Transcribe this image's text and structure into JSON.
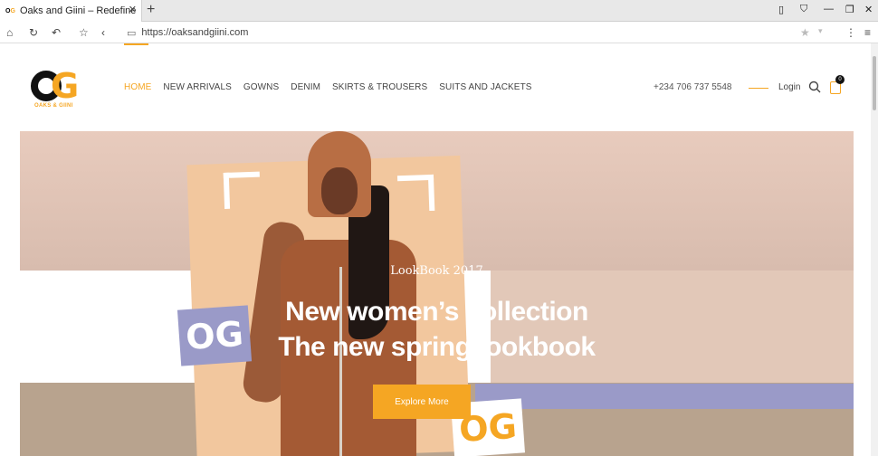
{
  "browser": {
    "tab_title": "Oaks and Giini – Redefine You",
    "tab_close": "✕",
    "new_tab": "+",
    "url": "https://oaksandgiini.com"
  },
  "site": {
    "logo_tag": "OAKS & GIINI",
    "nav": [
      {
        "label": "HOME",
        "active": true
      },
      {
        "label": "NEW ARRIVALS"
      },
      {
        "label": "GOWNS"
      },
      {
        "label": "DENIM"
      },
      {
        "label": "SKIRTS & TROUSERS"
      },
      {
        "label": "SUITS AND JACKETS"
      }
    ],
    "phone": "+234 706 737 5548",
    "login": "Login",
    "cart_count": "0"
  },
  "hero": {
    "eyebrow": "LookBook 2017",
    "headline_1": "New women’s collection",
    "headline_2": "The new spring lookbook",
    "cta": "Explore More",
    "badge_text": "OG"
  },
  "colors": {
    "accent": "#f5a623",
    "purple": "#9a9ac8"
  }
}
